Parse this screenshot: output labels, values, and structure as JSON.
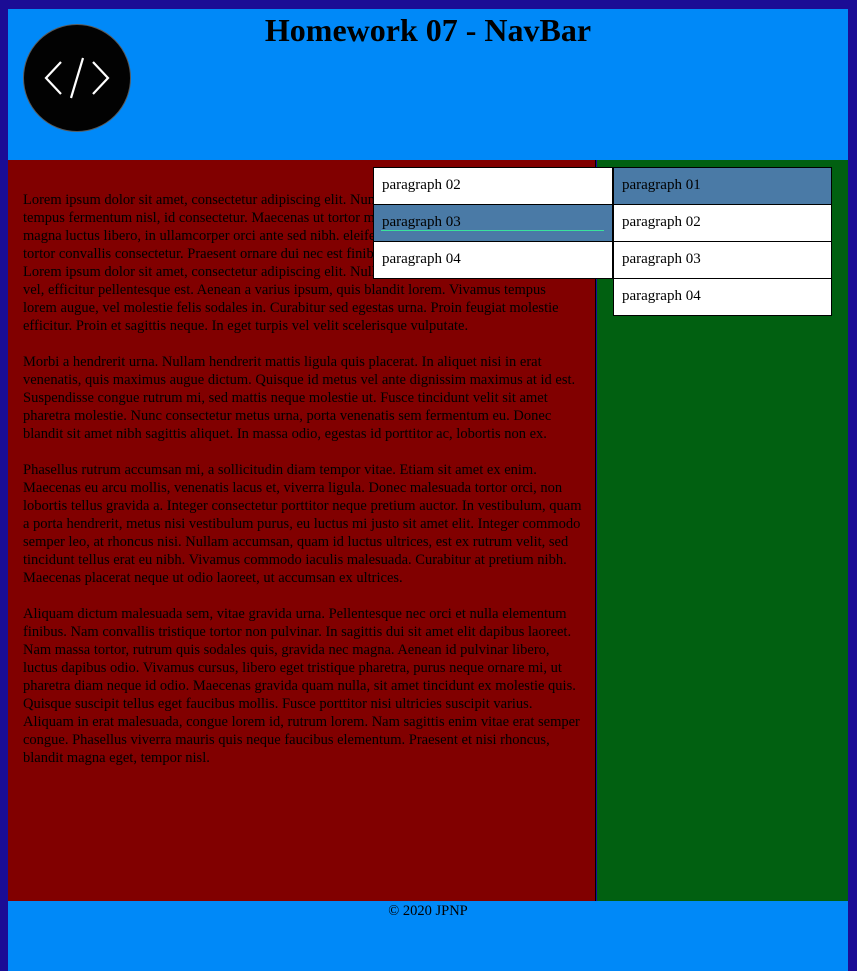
{
  "header": {
    "title": "Homework 07 - NavBar",
    "logo_icon": "code-brackets-icon"
  },
  "nav_float": [
    {
      "label": "paragraph 02",
      "active": false
    },
    {
      "label": "paragraph 03",
      "active": true
    },
    {
      "label": "paragraph 04",
      "active": false
    }
  ],
  "nav_side": [
    {
      "label": "paragraph 01",
      "active": true
    },
    {
      "label": "paragraph 02",
      "active": false
    },
    {
      "label": "paragraph 03",
      "active": false
    },
    {
      "label": "paragraph 04",
      "active": false
    }
  ],
  "main": {
    "paragraphs": [
      "Lorem ipsum dolor sit amet, consectetur adipiscing elit. Nunc vitae elit tempor mattis. Integer tempus fermentum nisl, id consectetur. Maecenas ut tortor massa. Curabitur ullamcorper, lorem magna luctus libero, in ullamcorper orci ante sed nibh. eleifend pretium. Fusce sagittis orci quis tortor convallis consectetur. Praesent ornare dui nec est finibus, non varius quam sollicitudin. Lorem ipsum dolor sit amet, consectetur adipiscing elit. Nulla ex lectus, tristique sit amet libero vel, efficitur pellentesque est. Aenean a varius ipsum, quis blandit lorem. Vivamus tempus lorem augue, vel molestie felis sodales in. Curabitur sed egestas urna. Proin feugiat molestie efficitur. Proin et sagittis neque. In eget turpis vel velit scelerisque vulputate.",
      "Morbi a hendrerit urna. Nullam hendrerit mattis ligula quis placerat. In aliquet nisi in erat venenatis, quis maximus augue dictum. Quisque id metus vel ante dignissim maximus at id est. Suspendisse congue rutrum mi, sed mattis neque molestie ut. Fusce tincidunt velit sit amet pharetra molestie. Nunc consectetur metus urna, porta venenatis sem fermentum eu. Donec blandit sit amet nibh sagittis aliquet. In massa odio, egestas id porttitor ac, lobortis non ex.",
      "Phasellus rutrum accumsan mi, a sollicitudin diam tempor vitae. Etiam sit amet ex enim. Maecenas eu arcu mollis, venenatis lacus et, viverra ligula. Donec malesuada tortor orci, non lobortis tellus gravida a. Integer consectetur porttitor neque pretium auctor. In vestibulum, quam a porta hendrerit, metus nisi vestibulum purus, eu luctus mi justo sit amet elit. Integer commodo semper leo, at rhoncus nisi. Nullam accumsan, quam id luctus ultrices, est ex rutrum velit, sed tincidunt tellus erat eu nibh. Vivamus commodo iaculis malesuada. Curabitur at pretium nibh. Maecenas placerat neque ut odio laoreet, ut accumsan ex ultrices.",
      "Aliquam dictum malesuada sem, vitae gravida urna. Pellentesque nec orci et nulla elementum finibus. Nam convallis tristique tortor non pulvinar. In sagittis dui sit amet elit dapibus laoreet. Nam massa tortor, rutrum quis sodales quis, gravida nec magna. Aenean id pulvinar libero, luctus dapibus odio. Vivamus cursus, libero eget tristique pharetra, purus neque ornare mi, ut pharetra diam neque id odio. Maecenas gravida quam nulla, sit amet tincidunt ex molestie quis. Quisque suscipit tellus eget faucibus mollis. Fusce porttitor nisi ultricies suscipit varius. Aliquam in erat malesuada, congue lorem id, rutrum lorem. Nam sagittis enim vitae erat semper congue. Phasellus viverra mauris quis neque faucibus elementum. Praesent et nisi rhoncus, blandit magna eget, tempor nisl."
    ]
  },
  "footer": {
    "copyright": "© 2020 JPNP"
  },
  "colors": {
    "page_background": "#1b0c95",
    "header_background": "#0089f8",
    "main_background": "#810000",
    "aside_background": "#016011",
    "nav_active": "#4a7aa6",
    "nav_inactive": "#ffffff",
    "nav_underline": "#39e39d"
  }
}
